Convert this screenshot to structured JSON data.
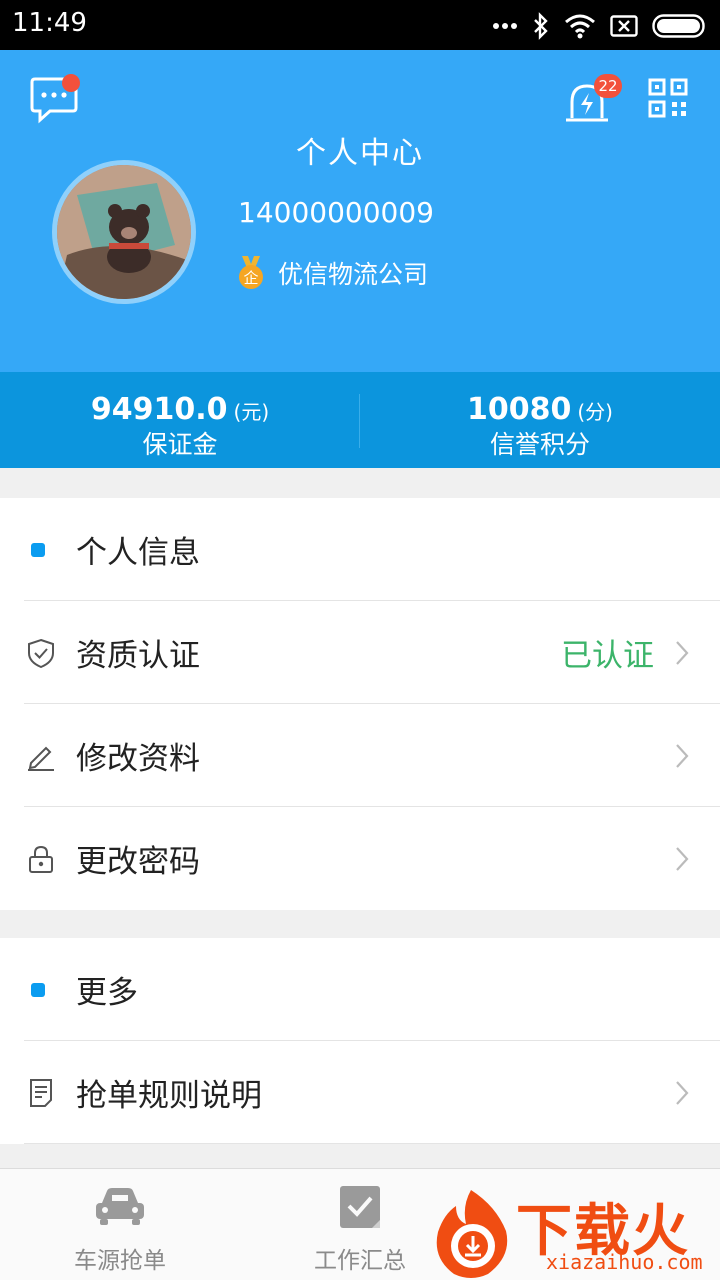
{
  "status_bar": {
    "time": "11:49"
  },
  "header": {
    "title": "个人中心",
    "alarm_badge": "22"
  },
  "profile": {
    "phone": "14000000009",
    "medal_char": "企",
    "company": "优信物流公司"
  },
  "stats": {
    "deposit": {
      "value": "94910.0",
      "unit": "(元)",
      "label": "保证金"
    },
    "credit": {
      "value": "10080",
      "unit": "(分)",
      "label": "信誉积分"
    }
  },
  "section1": {
    "heading": "个人信息",
    "items": [
      {
        "label": "资质认证",
        "status": "已认证",
        "icon": "shield-check-icon"
      },
      {
        "label": "修改资料",
        "icon": "pencil-icon"
      },
      {
        "label": "更改密码",
        "icon": "lock-icon"
      }
    ]
  },
  "section2": {
    "heading": "更多",
    "items": [
      {
        "label": "抢单规则说明",
        "icon": "document-icon"
      }
    ]
  },
  "tabbar": {
    "tabs": [
      {
        "label": "车源抢单",
        "icon": "car-icon"
      },
      {
        "label": "工作汇总",
        "icon": "checkbox-icon"
      }
    ]
  },
  "watermark": {
    "text": "下载火",
    "url": "xiazaihuo.com"
  },
  "colors": {
    "header_bg": "#35a8f7",
    "stats_bg": "#0c95dd",
    "accent_dot": "#0b9cf0",
    "verified": "#3cb46a",
    "badge": "#f2513c"
  }
}
